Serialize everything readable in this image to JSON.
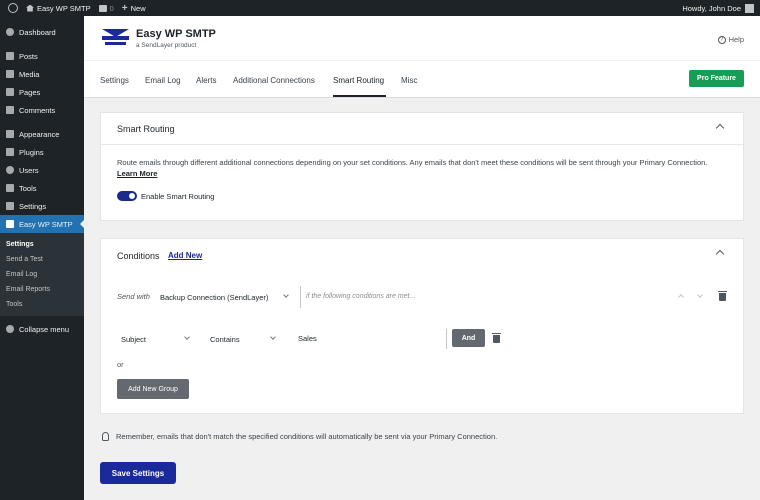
{
  "adminbar": {
    "site_name": "Easy WP SMTP",
    "comments_count": "0",
    "new_label": "New",
    "howdy": "Howdy, John Doe"
  },
  "sidebar": {
    "items": [
      {
        "label": "Dashboard",
        "icon": "dashboard-icon"
      },
      {
        "label": "Posts",
        "icon": "pin-icon"
      },
      {
        "label": "Media",
        "icon": "media-icon"
      },
      {
        "label": "Pages",
        "icon": "pages-icon"
      },
      {
        "label": "Comments",
        "icon": "comments-icon"
      },
      {
        "label": "Appearance",
        "icon": "brush-icon"
      },
      {
        "label": "Plugins",
        "icon": "plugin-icon"
      },
      {
        "label": "Users",
        "icon": "users-icon"
      },
      {
        "label": "Tools",
        "icon": "wrench-icon"
      },
      {
        "label": "Settings",
        "icon": "settings-icon"
      },
      {
        "label": "Easy WP SMTP",
        "icon": "smtp-icon"
      }
    ],
    "submenu": [
      "Settings",
      "Send a Test",
      "Email Log",
      "Email Reports",
      "Tools"
    ],
    "collapse_label": "Collapse menu"
  },
  "header": {
    "title": "Easy WP SMTP",
    "subtitle": "a SendLayer product",
    "help_label": "Help"
  },
  "tabs": [
    "Settings",
    "Email Log",
    "Alerts",
    "Additional Connections",
    "Smart Routing",
    "Misc"
  ],
  "active_tab": "Smart Routing",
  "pro_feature_label": "Pro Feature",
  "smart_routing": {
    "title": "Smart Routing",
    "description": "Route emails through different additional connections depending on your set conditions. Any emails that don't meet these conditions will be sent through your Primary Connection.",
    "learn_more": "Learn More",
    "toggle_label": "Enable Smart Routing",
    "enabled": true
  },
  "conditions": {
    "title": "Conditions",
    "add_new": "Add New",
    "send_with_label": "Send with",
    "send_with_value": "Backup Connection (SendLayer)",
    "if_text": "if the following conditions are met...",
    "field_value": "Subject",
    "operator_value": "Contains",
    "match_value": "Sales",
    "and_label": "And",
    "or_label": "or",
    "add_group_label": "Add New Group"
  },
  "reminder": "Remember, emails that don't match the specified conditions will automatically be sent via your Primary Connection.",
  "save_label": "Save Settings",
  "colors": {
    "admin_dark": "#1d2327",
    "admin_blue": "#2271b1",
    "brand_navy": "#1b2a9a",
    "pro_green": "#169e56"
  }
}
